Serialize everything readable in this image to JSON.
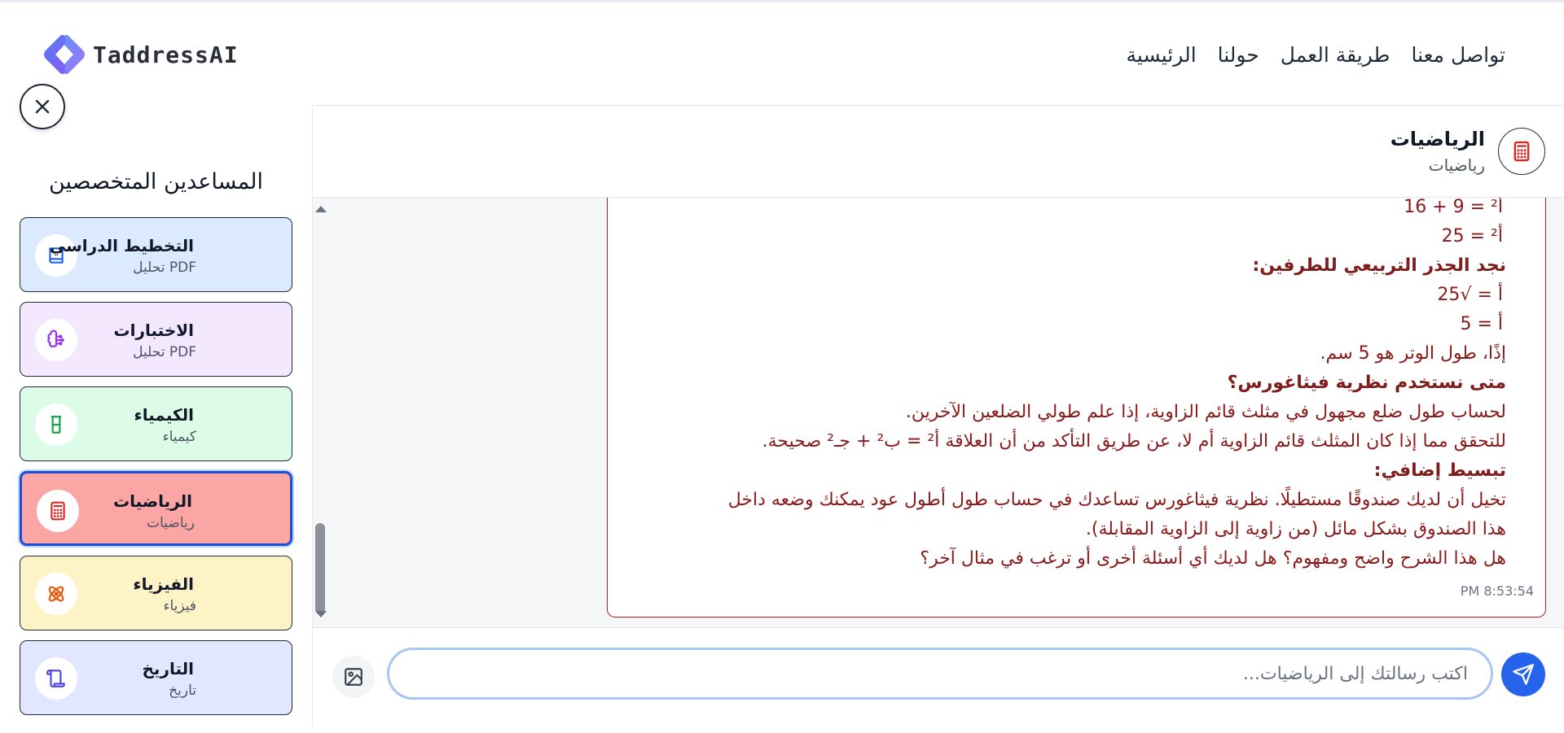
{
  "app": {
    "brand": "TaddressAI"
  },
  "nav": {
    "home": "الرئيسية",
    "about": "حولنا",
    "how_it_works": "طريقة العمل",
    "contact": "تواصل معنا"
  },
  "sidebar": {
    "title": "المساعدين المتخصصين",
    "items": [
      {
        "label": "التخطيط الدراسي",
        "sub": "PDF تحليل",
        "bg": "#dbeafe",
        "icon": "book-icon",
        "icon_color": "#2563eb"
      },
      {
        "label": "الاختبارات",
        "sub": "PDF تحليل",
        "bg": "#f3e8ff",
        "icon": "brain-icon",
        "icon_color": "#9333ea"
      },
      {
        "label": "الكيمياء",
        "sub": "كيمياء",
        "bg": "#dcfce7",
        "icon": "flask-icon",
        "icon_color": "#16a34a"
      },
      {
        "label": "الرياضيات",
        "sub": "رياضيات",
        "bg": "#fca5a5",
        "icon": "calculator-icon",
        "icon_color": "#dc2626",
        "active": true
      },
      {
        "label": "الفيزياء",
        "sub": "فيزياء",
        "bg": "#fef3c7",
        "icon": "atom-icon",
        "icon_color": "#ea580c"
      },
      {
        "label": "التاريخ",
        "sub": "تاريخ",
        "bg": "#e0e7ff",
        "icon": "scroll-icon",
        "icon_color": "#4f46e5"
      }
    ]
  },
  "chat": {
    "subject_name": "الرياضيات",
    "subject_sub": "رياضيات",
    "message_lines": [
      {
        "text": "أ² = 9 + 16",
        "kind": "eq"
      },
      {
        "text": "أ² = 25",
        "kind": "eq"
      },
      {
        "text": "نجد الجذر التربيعي للطرفين:",
        "kind": "h"
      },
      {
        "text": "أ = √25",
        "kind": "eq"
      },
      {
        "text": "أ = 5",
        "kind": "eq"
      },
      {
        "text": "إذًا، طول الوتر هو 5 سم.",
        "kind": "p"
      },
      {
        "text": "متى نستخدم نظرية فيثاغورس؟",
        "kind": "h"
      },
      {
        "text": "لحساب طول ضلع مجهول في مثلث قائم الزاوية، إذا علم طولي الضلعين الآخرين.",
        "kind": "p"
      },
      {
        "text": "للتحقق مما إذا كان المثلث قائم الزاوية أم لا، عن طريق التأكد من أن العلاقة أ² = ب² + جـ² صحيحة.",
        "kind": "p"
      },
      {
        "text": "تبسيط إضافي:",
        "kind": "h"
      },
      {
        "text": "تخيل أن لديك صندوقًا مستطيلًا. نظرية فيثاغورس تساعدك في حساب طول أطول عود يمكنك وضعه داخل",
        "kind": "p"
      },
      {
        "text": "هذا الصندوق بشكل مائل (من زاوية إلى الزاوية المقابلة).",
        "kind": "p"
      },
      {
        "text": "هل هذا الشرح واضح ومفهوم؟ هل لديك أي أسئلة أخرى أو ترغب في مثال آخر؟",
        "kind": "p"
      }
    ],
    "timestamp": "PM 8:53:54",
    "input_placeholder": "اكتب رسالتك إلى الرياضيات...",
    "input_value": ""
  },
  "colors": {
    "accent": "#2563eb",
    "message_border": "#b91c1c",
    "message_text": "#8b1a1a"
  }
}
